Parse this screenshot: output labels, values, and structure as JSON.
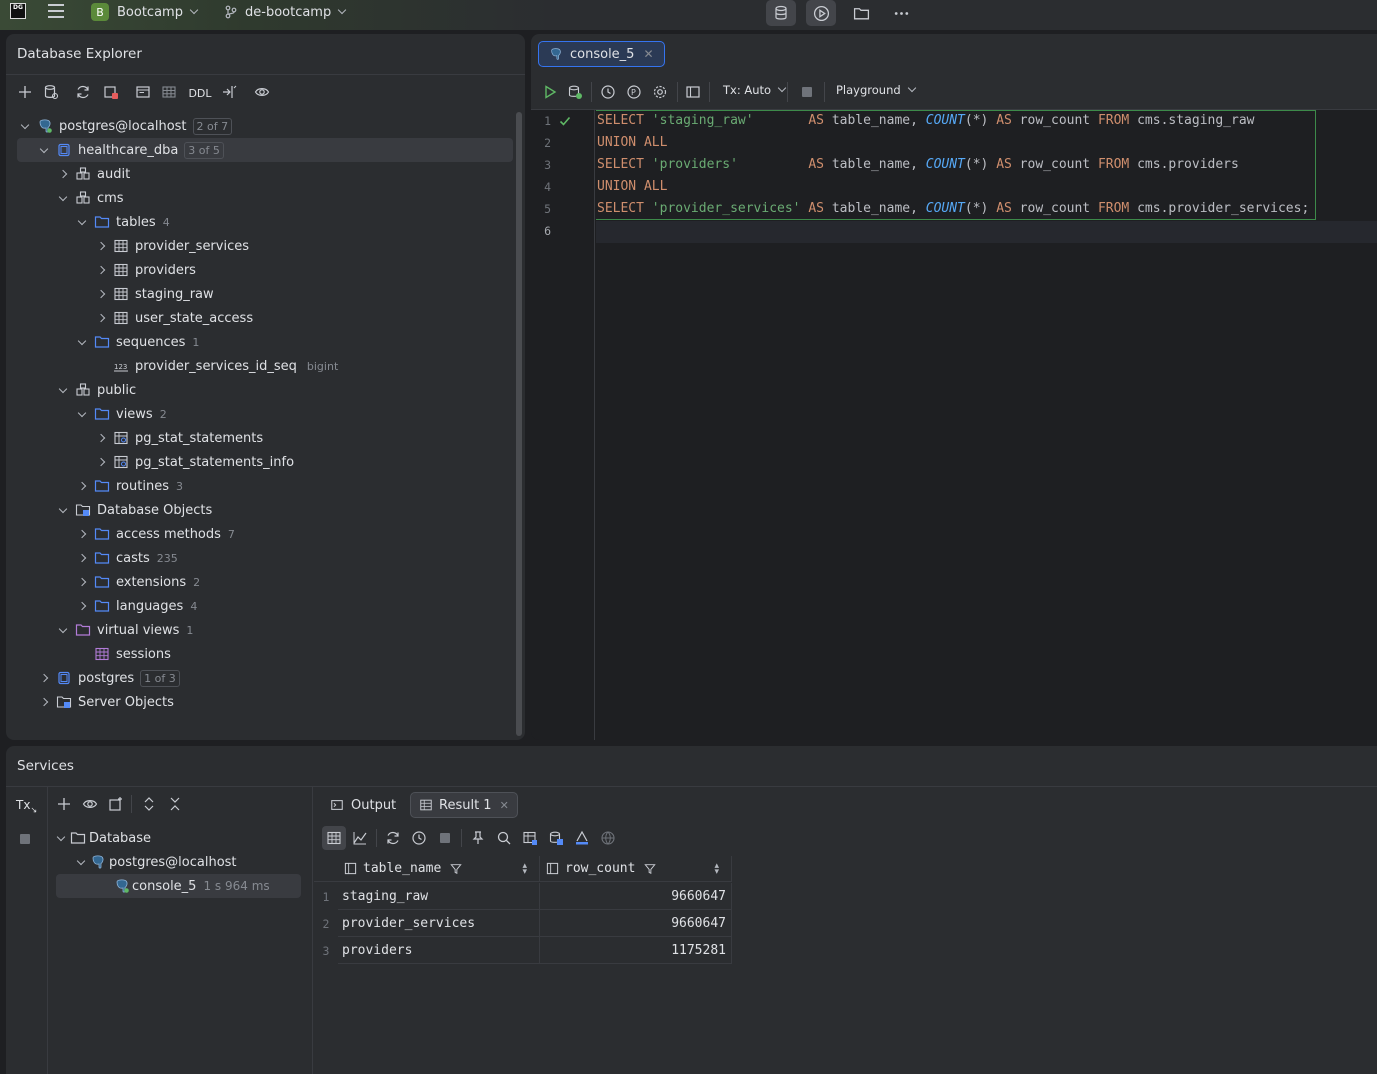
{
  "topbar": {
    "app_logo": "DG",
    "project_badge": "B",
    "project": "Bootcamp",
    "branch": "de-bootcamp",
    "icons": [
      "database-icon",
      "run-icon",
      "folder-icon",
      "more-icon"
    ]
  },
  "explorer": {
    "title": "Database Explorer",
    "toolbar_ddl": "DDL",
    "tree": [
      {
        "label": "postgres@localhost",
        "badge": "2 of 7",
        "icon": "postgres-icon"
      },
      {
        "label": "healthcare_dba",
        "badge": "3 of 5",
        "icon": "database-icon"
      },
      {
        "label": "audit",
        "icon": "schema-icon"
      },
      {
        "label": "cms",
        "icon": "schema-icon"
      },
      {
        "label": "tables",
        "count": "4",
        "icon": "folder-icon"
      },
      {
        "label": "provider_services",
        "icon": "table-icon"
      },
      {
        "label": "providers",
        "icon": "table-icon"
      },
      {
        "label": "staging_raw",
        "icon": "table-icon"
      },
      {
        "label": "user_state_access",
        "icon": "table-icon"
      },
      {
        "label": "sequences",
        "count": "1",
        "icon": "folder-icon"
      },
      {
        "label": "provider_services_id_seq",
        "type": "bigint",
        "icon": "sequence-icon"
      },
      {
        "label": "public",
        "icon": "schema-icon"
      },
      {
        "label": "views",
        "count": "2",
        "icon": "folder-icon"
      },
      {
        "label": "pg_stat_statements",
        "icon": "view-icon"
      },
      {
        "label": "pg_stat_statements_info",
        "icon": "view-icon"
      },
      {
        "label": "routines",
        "count": "3",
        "icon": "folder-icon"
      },
      {
        "label": "Database Objects",
        "icon": "db-objects-icon"
      },
      {
        "label": "access methods",
        "count": "7",
        "icon": "folder-icon"
      },
      {
        "label": "casts",
        "count": "235",
        "icon": "folder-icon"
      },
      {
        "label": "extensions",
        "count": "2",
        "icon": "folder-icon"
      },
      {
        "label": "languages",
        "count": "4",
        "icon": "folder-icon"
      },
      {
        "label": "virtual views",
        "count": "1",
        "icon": "folder-purple-icon"
      },
      {
        "label": "sessions",
        "icon": "virtual-view-icon"
      },
      {
        "label": "postgres",
        "badge": "1 of 3",
        "icon": "database-icon"
      },
      {
        "label": "Server Objects",
        "icon": "server-objects-icon"
      }
    ]
  },
  "editor": {
    "tab_label": "console_5",
    "tx_label": "Tx: Auto",
    "playground_label": "Playground",
    "line_numbers": [
      "1",
      "2",
      "3",
      "4",
      "5",
      "6"
    ],
    "code": {
      "l1": {
        "kw1": "SELECT",
        "str": "'staging_raw'",
        "pad": "       ",
        "kw2": "AS",
        "t1": " table_name, ",
        "fn": "COUNT",
        "t2": "(*) ",
        "kw3": "AS",
        "t3": " row_count ",
        "kw4": "FROM",
        "t4": " cms.staging_raw"
      },
      "l2": "UNION ALL",
      "l3": {
        "kw1": "SELECT",
        "str": "'providers'",
        "pad": "         ",
        "kw2": "AS",
        "t1": " table_name, ",
        "fn": "COUNT",
        "t2": "(*) ",
        "kw3": "AS",
        "t3": " row_count ",
        "kw4": "FROM",
        "t4": " cms.providers"
      },
      "l4": "UNION ALL",
      "l5": {
        "kw1": "SELECT",
        "str": "'provider_services'",
        "pad": " ",
        "kw2": "AS",
        "t1": " table_name, ",
        "fn": "COUNT",
        "t2": "(*) ",
        "kw3": "AS",
        "t3": " row_count ",
        "kw4": "FROM",
        "t4": " cms.provider_services;"
      }
    }
  },
  "services": {
    "title": "Services",
    "tx_label": "Tx",
    "tree": [
      {
        "label": "Database"
      },
      {
        "label": "postgres@localhost"
      },
      {
        "label": "console_5",
        "time": "1 s 964 ms"
      }
    ],
    "tabs": {
      "output": "Output",
      "result": "Result 1"
    },
    "grid": {
      "columns": [
        "table_name",
        "row_count"
      ],
      "rows": [
        {
          "num": "1",
          "table_name": "staging_raw",
          "row_count": "9660647"
        },
        {
          "num": "2",
          "table_name": "provider_services",
          "row_count": "9660647"
        },
        {
          "num": "3",
          "table_name": "providers",
          "row_count": "1175281"
        }
      ]
    }
  },
  "colors": {
    "accent": "#3574f0",
    "keyword": "#cf8e6d",
    "string": "#6aab73",
    "function": "#56a8f5",
    "run_green": "#5fb865"
  }
}
